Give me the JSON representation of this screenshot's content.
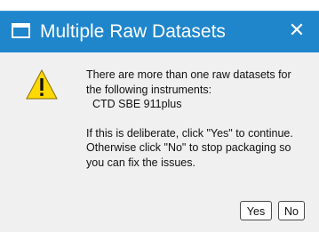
{
  "dialog": {
    "title": "Multiple Raw Datasets",
    "close_glyph": "✕",
    "icon": "warning-icon",
    "message_lines_1": [
      "There are more than one raw datasets for",
      "the following instruments:"
    ],
    "instrument": "CTD SBE 911plus",
    "message_lines_2": [
      "If this is deliberate, click \"Yes\" to continue.",
      "Otherwise click \"No\" to stop packaging so",
      "you can fix the issues."
    ],
    "yes_label": "Yes",
    "no_label": "No"
  },
  "colors": {
    "titlebar": "#1f86cc",
    "body": "#f0f0f0",
    "warning_fill": "#ffd800"
  }
}
